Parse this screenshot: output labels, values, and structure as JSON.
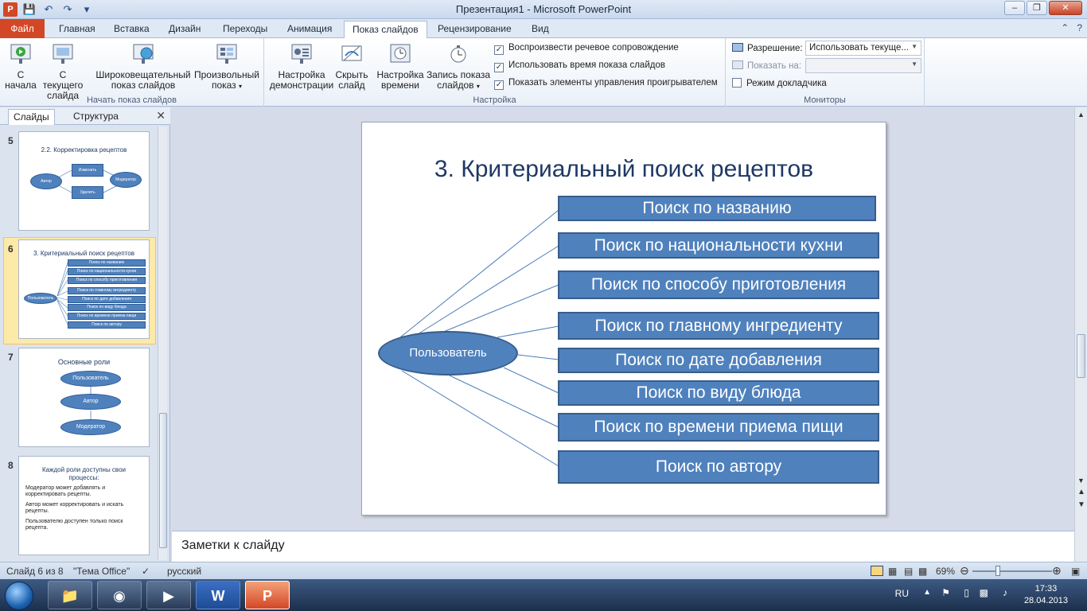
{
  "window": {
    "title": "Презентация1  -  Microsoft PowerPoint",
    "app_icon_letter": "P",
    "controls": [
      "–",
      "❐",
      "✕"
    ]
  },
  "tabs": [
    {
      "label": "Файл",
      "name": "tab-file"
    },
    {
      "label": "Главная",
      "name": "tab-home"
    },
    {
      "label": "Вставка",
      "name": "tab-insert"
    },
    {
      "label": "Дизайн",
      "name": "tab-design"
    },
    {
      "label": "Переходы",
      "name": "tab-transitions"
    },
    {
      "label": "Анимация",
      "name": "tab-animation"
    },
    {
      "label": "Показ слайдов",
      "name": "tab-slideshow"
    },
    {
      "label": "Рецензирование",
      "name": "tab-review"
    },
    {
      "label": "Вид",
      "name": "tab-view"
    }
  ],
  "ribbon": {
    "group_start": {
      "label": "Начать показ слайдов",
      "from_start": "С\nначала",
      "from_current": "С текущего\nслайда",
      "broadcast": "Широковещательный\nпоказ слайдов",
      "custom": "Произвольный\nпоказ"
    },
    "group_setup": {
      "label": "Настройка",
      "setup_show": "Настройка\nдемонстрации",
      "hide_slide": "Скрыть\nслайд",
      "rehearse": "Настройка\nвремени",
      "record": "Запись показа\nслайдов",
      "chk_narration": "Воспроизвести речевое сопровождение",
      "chk_timings": "Использовать время показа слайдов",
      "chk_controls": "Показать элементы управления проигрывателем"
    },
    "group_monitors": {
      "label": "Мониторы",
      "resolution_label": "Разрешение:",
      "resolution_value": "Использовать текуще...",
      "show_on_label": "Показать на:",
      "show_on_value": "",
      "presenter_view": "Режим докладчика"
    }
  },
  "leftpane": {
    "tab_slides": "Слайды",
    "tab_outline": "Структура",
    "close": "✕",
    "thumbs": [
      {
        "num": "5",
        "title": "2.2. Корректировка рецептов",
        "nodes": [
          "Автор",
          "Изменить",
          "Удалить",
          "Модератор"
        ]
      },
      {
        "num": "6",
        "title": "3. Критериальный поиск рецептов",
        "ellipse": "Пользователь",
        "items": [
          "Поиск по названию",
          "Поиск по национальности кухни",
          "Поиск по способу приготовления",
          "Поиск по главному ингредиенту",
          "Поиск по дате добавления",
          "Поиск по виду блюда",
          "Поиск по времени приема пищи",
          "Поиск по автору"
        ]
      },
      {
        "num": "7",
        "title": "Основные роли",
        "nodes": [
          "Пользователь",
          "Автор",
          "Модератор"
        ]
      },
      {
        "num": "8",
        "title": "Каждой роли доступны свои процессы:",
        "lines": [
          "Модератор может добавлять и корректировать рецепты.",
          "Автор может корректировать и искать рецепты.",
          "Пользователю доступен только поиск рецепта."
        ]
      }
    ]
  },
  "slide": {
    "title": "3. Критериальный поиск рецептов",
    "ellipse": "Пользователь",
    "items": [
      "Поиск по названию",
      "Поиск по национальности кухни",
      "Поиск по способу приготовления",
      "Поиск по главному ингредиенту",
      "Поиск по дате добавления",
      "Поиск по виду блюда",
      "Поиск по времени приема пищи",
      "Поиск по автору"
    ]
  },
  "notes": {
    "placeholder": "Заметки к слайду"
  },
  "status": {
    "slide_counter": "Слайд 6 из 8",
    "theme": "\"Тема Office\"",
    "language": "русский",
    "zoom": "69%"
  },
  "taskbar": {
    "lang": "RU",
    "time": "17:33",
    "date": "28.04.2013"
  },
  "colors": {
    "accent": "#4f81bd",
    "file_tab": "#d24726",
    "title_text": "#1f3864"
  }
}
